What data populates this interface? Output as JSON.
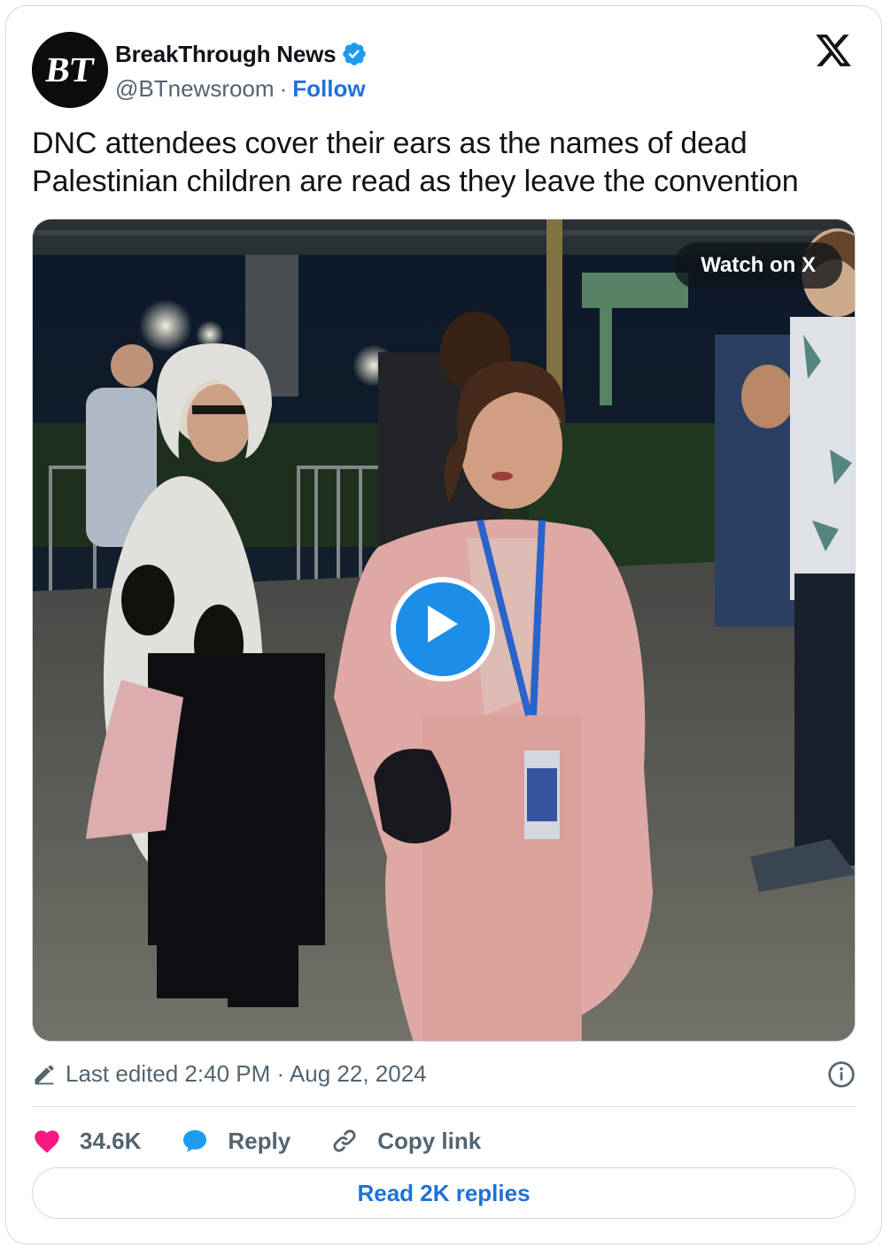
{
  "author": {
    "name": "BreakThrough News",
    "handle": "@BTnewsroom",
    "separator": "·",
    "follow_label": "Follow",
    "avatar_text": "BT",
    "verified": true
  },
  "tweet": {
    "text": "DNC attendees cover their ears as the names of dead Palestinian children are read as they leave the convention"
  },
  "media": {
    "type": "video",
    "watch_label": "Watch on X",
    "accent_color": "#1d8ee8"
  },
  "meta": {
    "edited_text": "Last edited 2:40 PM · Aug 22, 2024"
  },
  "actions": {
    "likes_count": "34.6K",
    "reply_label": "Reply",
    "copy_link_label": "Copy link",
    "read_replies_label": "Read 2K replies"
  },
  "colors": {
    "like": "#f91880",
    "reply": "#1d9bf0",
    "link": "#1d72d9",
    "muted": "#536471"
  },
  "icons": [
    "verified-badge-icon",
    "x-logo-icon",
    "play-icon",
    "pencil-icon",
    "info-icon",
    "heart-icon",
    "reply-bubble-icon",
    "link-icon"
  ]
}
